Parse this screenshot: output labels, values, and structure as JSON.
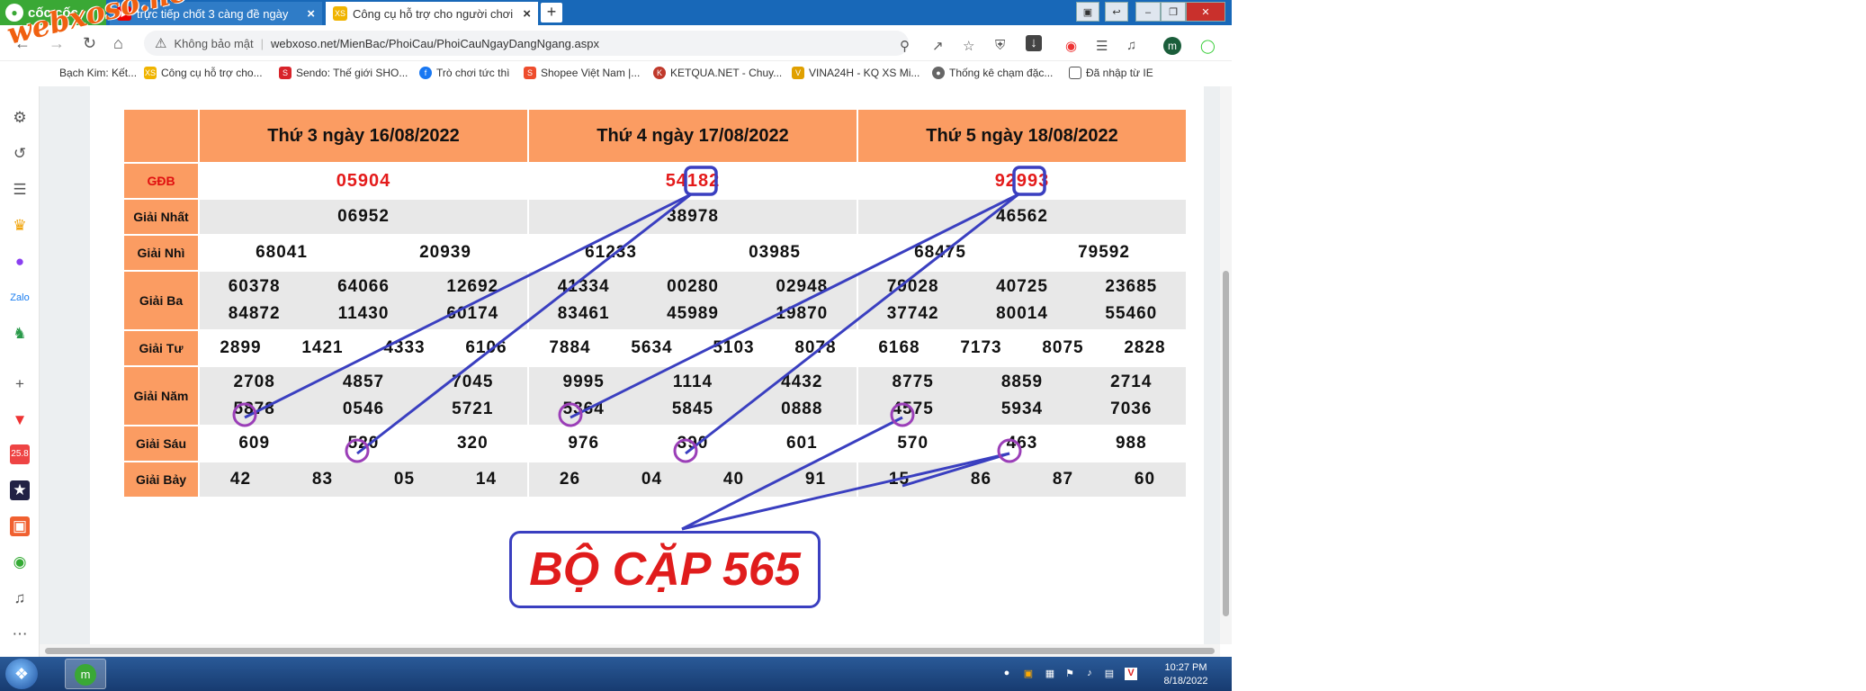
{
  "browser": {
    "brand": "cốc cốc",
    "tabs": [
      {
        "label": "trực tiếp chốt 3 càng đề ngày",
        "icon": "youtube-icon"
      },
      {
        "label": "Công cụ hỗ trợ cho người chơi",
        "icon": "xs-icon"
      }
    ],
    "security_label": "Không bảo mật",
    "url": "webxoso.net/MienBac/PhoiCau/PhoiCauNgayDangNgang.aspx",
    "avatar_letter": "m"
  },
  "bookmarks": [
    {
      "label": "Bạch Kim: Kết...",
      "color": "#f0a020"
    },
    {
      "label": "Công cụ hỗ trợ cho...",
      "color": "#f0b400"
    },
    {
      "label": "Sendo: Thế giới SHO...",
      "color": "#d8232a"
    },
    {
      "label": "Trò chơi tức thì",
      "color": "#1877f2"
    },
    {
      "label": "Shopee Việt Nam |...",
      "color": "#ee4d2d"
    },
    {
      "label": "KETQUA.NET - Chuy...",
      "color": "#c0392b"
    },
    {
      "label": "VINA24H - KQ XS Mi...",
      "color": "#e0a000"
    },
    {
      "label": "Thống kê chạm đặc...",
      "color": "#666666"
    },
    {
      "label": "Đã nhập từ IE",
      "color": "#888888"
    }
  ],
  "watermark": "webxoso.net",
  "results": {
    "headers": [
      "Thứ 3 ngày 16/08/2022",
      "Thứ 4 ngày 17/08/2022",
      "Thứ 5 ngày 18/08/2022"
    ],
    "rows": [
      {
        "label": "GĐB",
        "days": [
          [
            "05904"
          ],
          [
            "54182"
          ],
          [
            "92993"
          ]
        ]
      },
      {
        "label": "Giải Nhất",
        "days": [
          [
            "06952"
          ],
          [
            "38978"
          ],
          [
            "46562"
          ]
        ]
      },
      {
        "label": "Giải Nhì",
        "days": [
          [
            "68041",
            "20939"
          ],
          [
            "61233",
            "03985"
          ],
          [
            "68475",
            "79592"
          ]
        ]
      },
      {
        "label": "Giải Ba",
        "days": [
          [
            "60378",
            "64066",
            "12692",
            "84872",
            "11430",
            "60174"
          ],
          [
            "41334",
            "00280",
            "02948",
            "83461",
            "45989",
            "19870"
          ],
          [
            "79028",
            "40725",
            "23685",
            "37742",
            "80014",
            "55460"
          ]
        ]
      },
      {
        "label": "Giải Tư",
        "days": [
          [
            "2899",
            "1421",
            "4333",
            "6106"
          ],
          [
            "7884",
            "5634",
            "5103",
            "8078"
          ],
          [
            "6168",
            "7173",
            "8075",
            "2828"
          ]
        ]
      },
      {
        "label": "Giải Năm",
        "days": [
          [
            "2708",
            "4857",
            "7045",
            "5878",
            "0546",
            "5721"
          ],
          [
            "9995",
            "1114",
            "4432",
            "5364",
            "5845",
            "0888"
          ],
          [
            "8775",
            "8859",
            "2714",
            "4575",
            "5934",
            "7036"
          ]
        ]
      },
      {
        "label": "Giải Sáu",
        "days": [
          [
            "609",
            "520",
            "320"
          ],
          [
            "976",
            "390",
            "601"
          ],
          [
            "570",
            "463",
            "988"
          ]
        ]
      },
      {
        "label": "Giải Bảy",
        "days": [
          [
            "42",
            "83",
            "05",
            "14"
          ],
          [
            "26",
            "04",
            "40",
            "91"
          ],
          [
            "15",
            "86",
            "87",
            "60"
          ]
        ]
      }
    ]
  },
  "callout": "BỘ CẶP 565",
  "taskbar": {
    "time": "10:27 PM",
    "date": "8/18/2022"
  },
  "colors": {
    "header_orange": "#fb9c62",
    "special_red": "#e41b1b",
    "line_blue": "#3a3fc0",
    "circle_purple": "#9b3fb8"
  }
}
